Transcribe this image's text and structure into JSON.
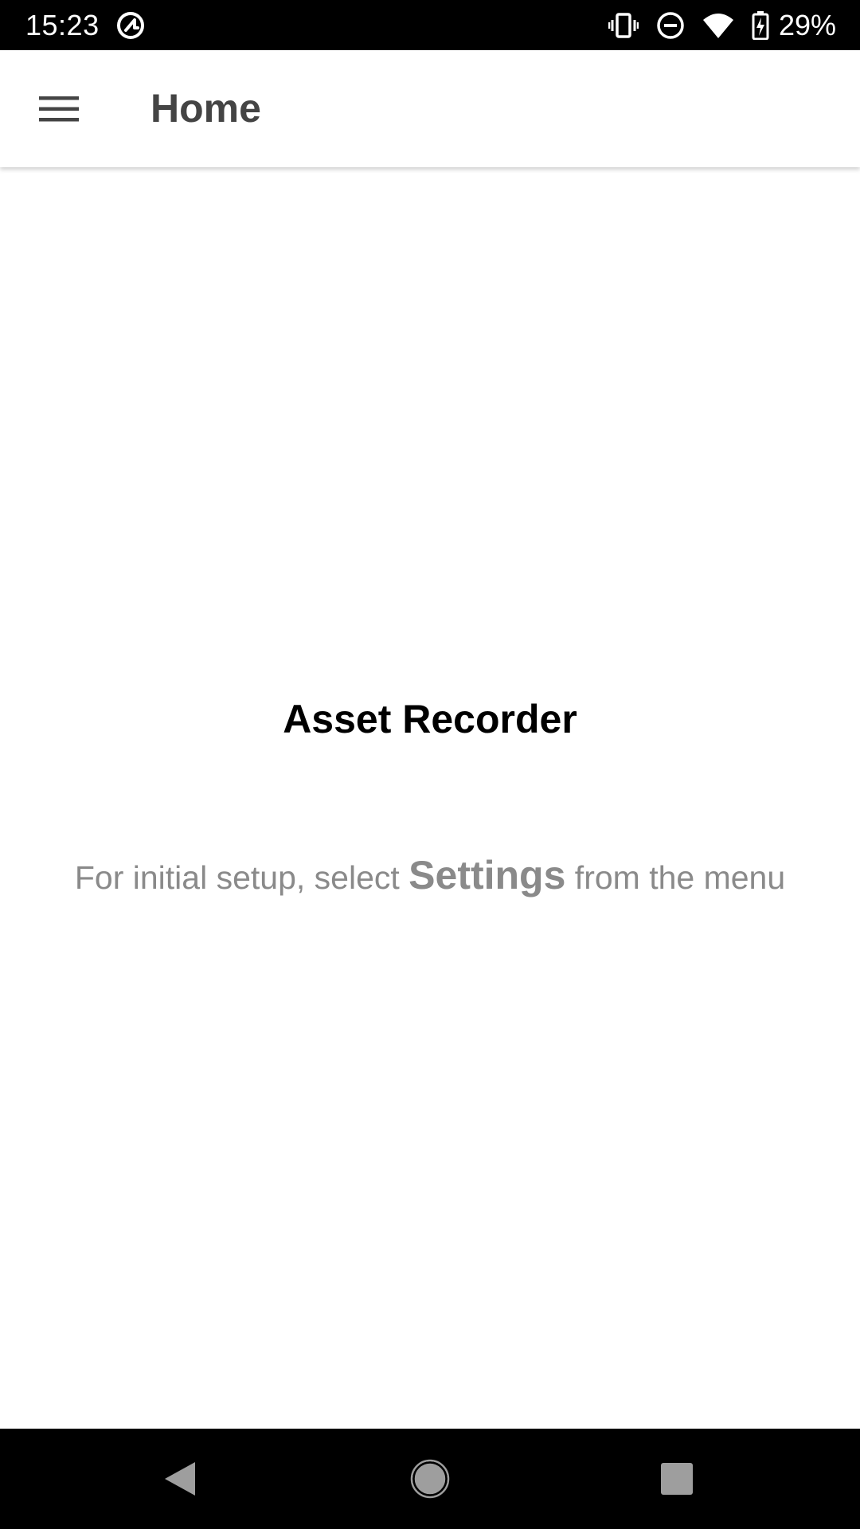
{
  "status_bar": {
    "time": "15:23",
    "battery_percent": "29%",
    "icons": [
      "at-sign-icon",
      "vibrate-icon",
      "do-not-disturb-icon",
      "wifi-icon",
      "battery-charging-icon"
    ]
  },
  "app_bar": {
    "menu_icon": "hamburger-menu-icon",
    "title": "Home"
  },
  "main": {
    "headline": "Asset Recorder",
    "hint_prefix": "For initial setup, select ",
    "hint_strong": "Settings",
    "hint_suffix": " from the menu"
  },
  "nav_bar": {
    "buttons": [
      "back-icon",
      "home-icon",
      "recents-icon"
    ]
  },
  "colors": {
    "status_bar_bg": "#000000",
    "app_bar_bg": "#ffffff",
    "title_text": "#444444",
    "headline_text": "#000000",
    "hint_text": "#8a8a8a",
    "nav_bar_bg": "#000000",
    "nav_icon": "#9e9e9e"
  }
}
